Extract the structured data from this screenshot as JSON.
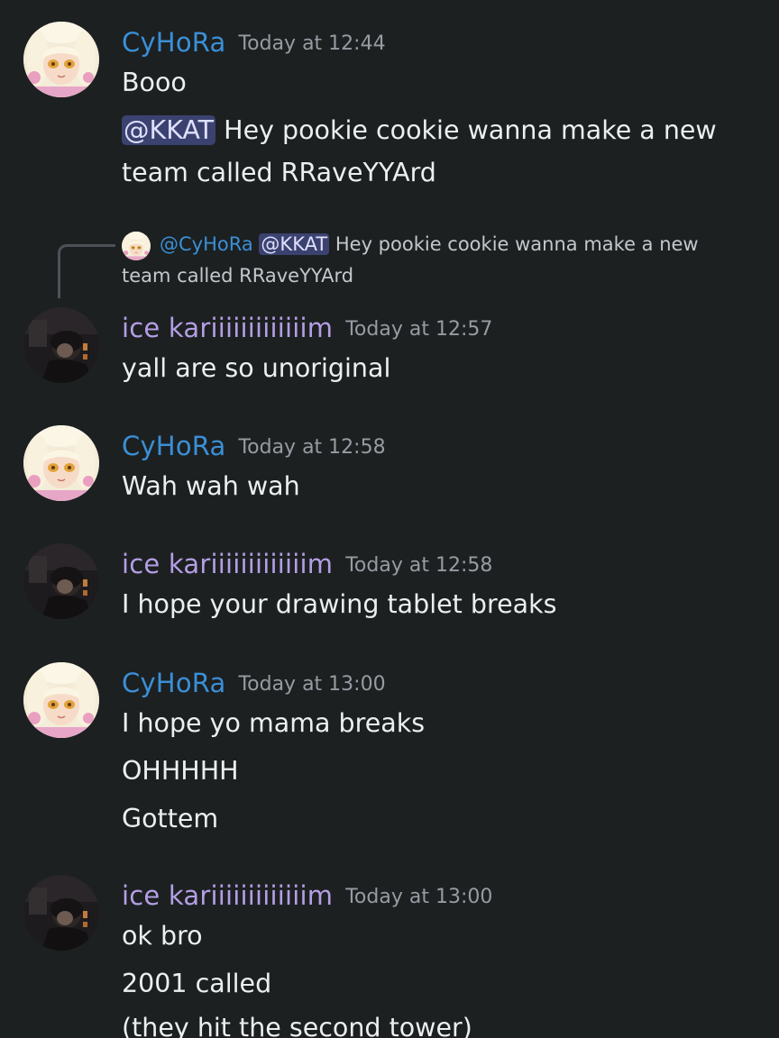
{
  "colors": {
    "background": "#1c2021",
    "cyhora_name": "#3b8fd6",
    "ice_name": "#b49ee4",
    "mention_bg": "#3c4270",
    "timestamp": "#979ba2"
  },
  "reply": {
    "author": "@CyHoRa",
    "mention": "@KKAT",
    "text_line1": "Hey pookie cookie wanna make a new",
    "text_line2": "team called RRaveYYArd"
  },
  "messages": [
    {
      "author": "CyHoRa",
      "time": "Today at 12:44",
      "lines": [
        "Booo"
      ],
      "mention": "@KKAT",
      "mention_line1": "Hey pookie cookie wanna make a new",
      "mention_line2": "team called RRaveYYArd"
    },
    {
      "author": "ice kariiiiiiiiiiiiim",
      "time": "Today at 12:57",
      "lines": [
        "yall are so unoriginal"
      ]
    },
    {
      "author": "CyHoRa",
      "time": "Today at 12:58",
      "lines": [
        "Wah wah wah"
      ]
    },
    {
      "author": "ice kariiiiiiiiiiiiim",
      "time": "Today at 12:58",
      "lines": [
        "I hope your drawing tablet breaks"
      ]
    },
    {
      "author": "CyHoRa",
      "time": "Today at 13:00",
      "lines": [
        "I hope yo mama breaks",
        "OHHHHH",
        "Gottem"
      ]
    },
    {
      "author": "ice kariiiiiiiiiiiiim",
      "time": "Today at 13:00",
      "lines": [
        "ok bro",
        "2001 called",
        "(they hit the second tower)"
      ]
    }
  ]
}
